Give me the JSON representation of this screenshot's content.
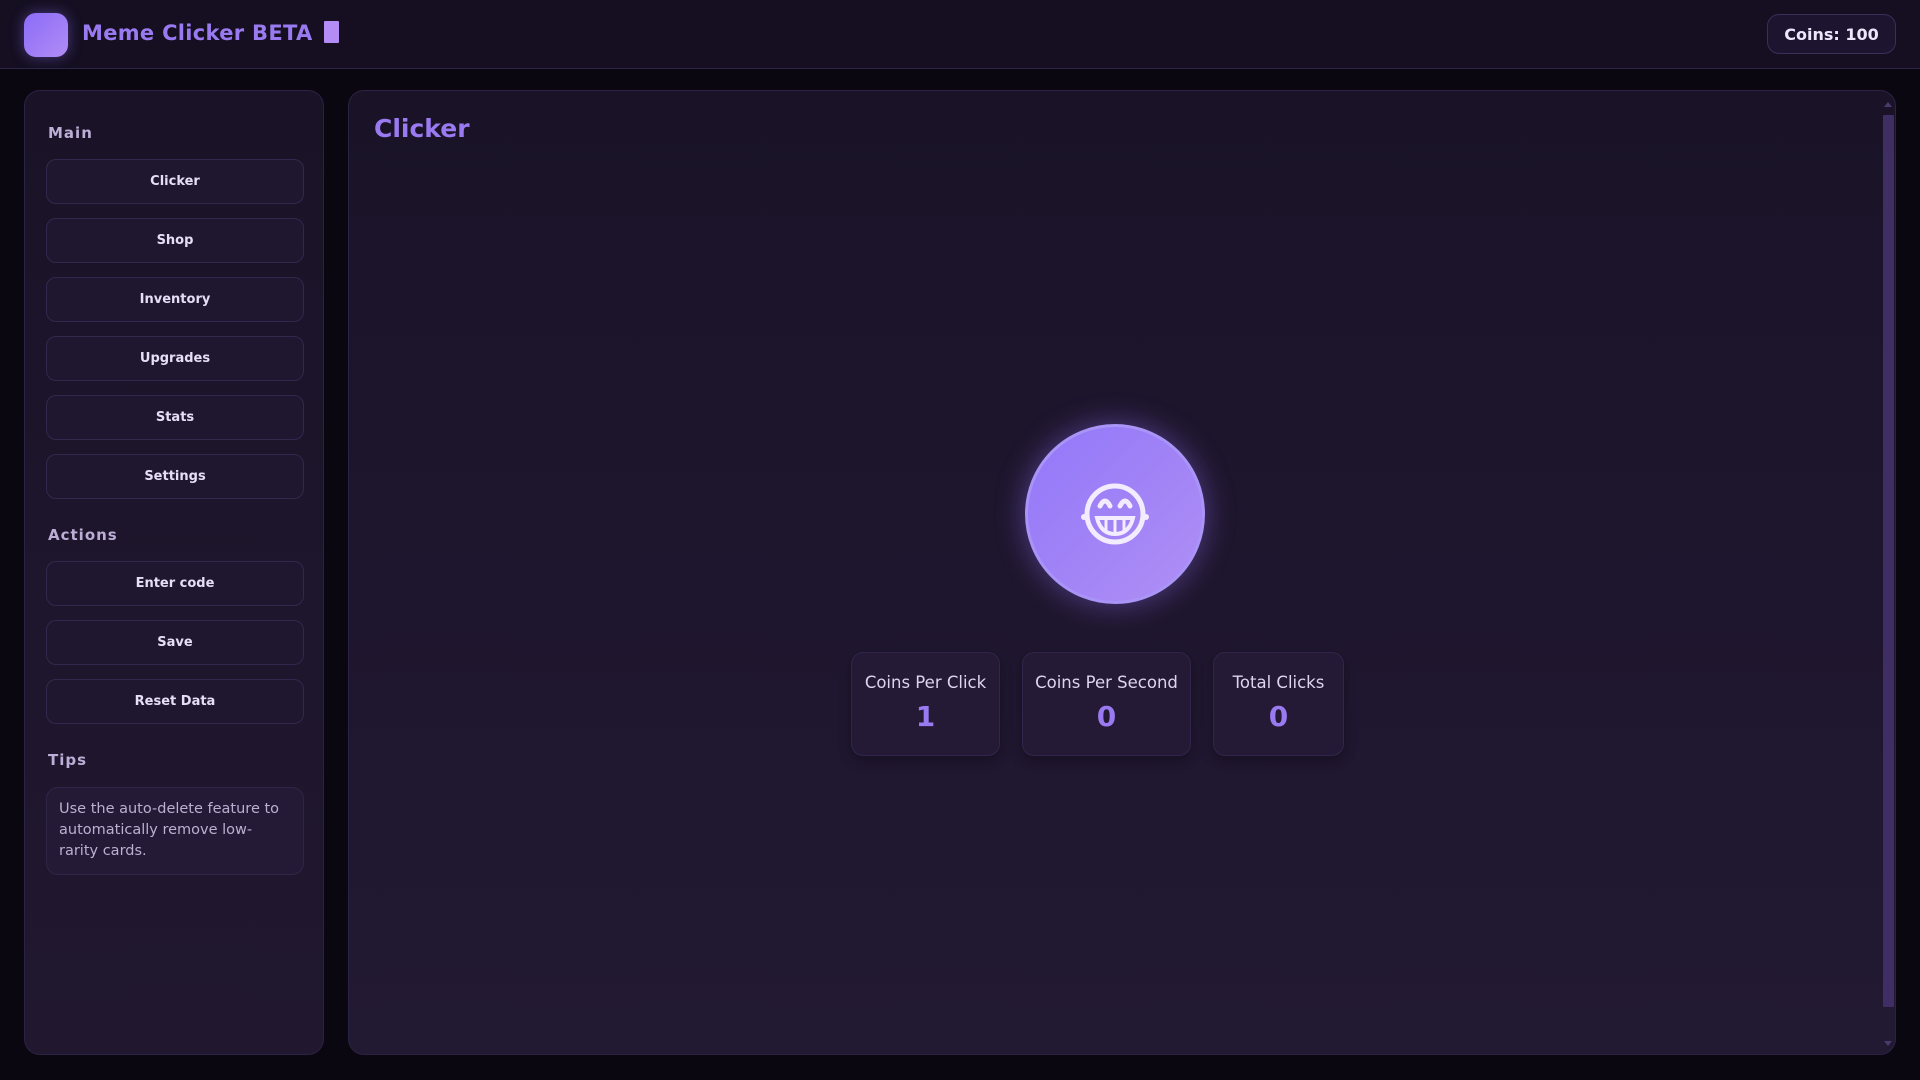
{
  "header": {
    "title": "Meme Clicker BETA",
    "coins_label": "Coins: 100"
  },
  "sidebar": {
    "main_heading": "Main",
    "main_items": [
      {
        "label": "Clicker"
      },
      {
        "label": "Shop"
      },
      {
        "label": "Inventory"
      },
      {
        "label": "Upgrades"
      },
      {
        "label": "Stats"
      },
      {
        "label": "Settings"
      }
    ],
    "actions_heading": "Actions",
    "action_items": [
      {
        "label": "Enter code"
      },
      {
        "label": "Save"
      },
      {
        "label": "Reset Data"
      }
    ],
    "tips_heading": "Tips",
    "tip_text": "Use the auto-delete feature to automatically remove low-rarity cards."
  },
  "main": {
    "title": "Clicker",
    "click_icon": "grinning-squint-face-icon",
    "stats": [
      {
        "label": "Coins Per Click",
        "value": "1"
      },
      {
        "label": "Coins Per Second",
        "value": "0"
      },
      {
        "label": "Total Clicks",
        "value": "0"
      }
    ]
  },
  "colors": {
    "accent": "#9a7af0",
    "background": "#0a0710",
    "panel": "#1a1328"
  }
}
